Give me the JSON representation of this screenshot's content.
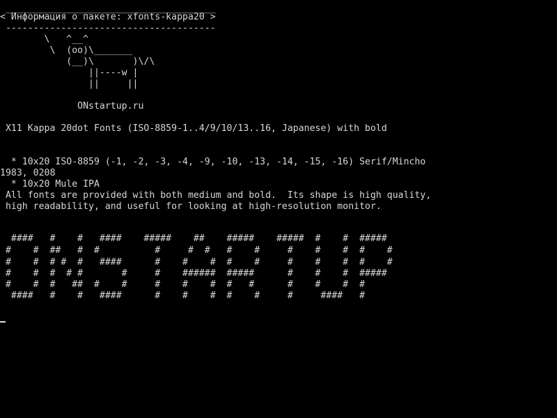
{
  "terminal": {
    "colors": {
      "background": "#000000",
      "foreground": "#d8d8d8"
    },
    "lines": [
      " ______________________________________",
      "< Информация о пакете: xfonts-kappa20 >",
      " --------------------------------------",
      "        \\   ^__^",
      "         \\  (oo)\\_______",
      "            (__)\\       )\\/\\",
      "                ||----w |",
      "                ||     ||",
      "",
      "              ONstartup.ru",
      "",
      " X11 Kappa 20dot Fonts (ISO-8859-1..4/9/10/13..16, Japanese) with bold",
      "",
      "",
      "  * 10x20 ISO-8859 (-1, -2, -3, -4, -9, -10, -13, -14, -15, -16) Serif/Mincho",
      "1983, 0208",
      "  * 10x20 Mule IPA",
      " All fonts are provided with both medium and bold.  Its shape is high quality,",
      " high readability, and useful for looking at high-resolution monitor.",
      "",
      "",
      "  ####   #    #   ####    #####    ##    #####    #####  #    #  #####",
      " #    #  ##   #  #          #     #  #   #    #     #    #    #  #    #",
      " #    #  # #  #   ####      #    #    #  #    #     #    #    #  #    #",
      " #    #  #  # #       #     #    ######  #####      #    #    #  #####",
      " #    #  #   ##  #    #     #    #    #  #   #      #    #    #  #",
      "  ####   #    #   ####      #    #    #  #    #     #     ####   #"
    ]
  }
}
